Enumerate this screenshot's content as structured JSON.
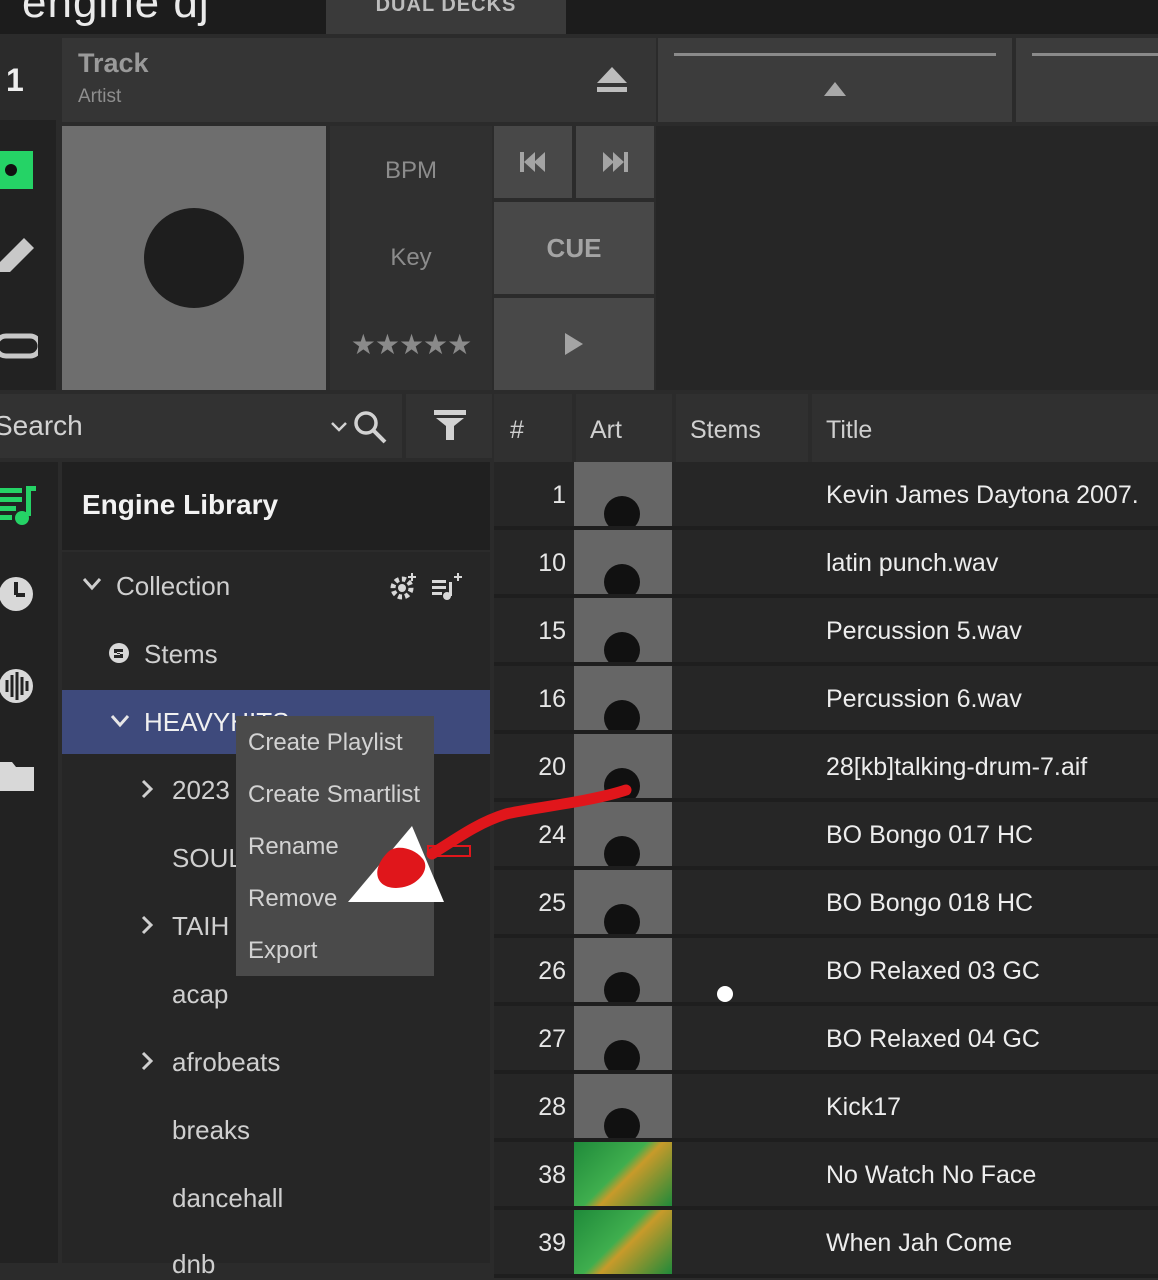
{
  "header": {
    "logo_text": "engine dj",
    "tab_label": "DUAL DECKS"
  },
  "deck": {
    "number": "1",
    "track_title": "Track",
    "artist": "Artist",
    "bpm_label": "BPM",
    "key_label": "Key",
    "rating_stars": "★★★★★",
    "cue_label": "CUE"
  },
  "search": {
    "placeholder": "Search"
  },
  "library": {
    "title": "Engine Library",
    "tree": [
      {
        "label": "Collection"
      },
      {
        "label": "Stems"
      },
      {
        "label": "HEAVYHITS"
      },
      {
        "label": "2023"
      },
      {
        "label": "SOUL"
      },
      {
        "label": "TAIH"
      },
      {
        "label": "acap"
      },
      {
        "label": "afrobeats"
      },
      {
        "label": "breaks"
      },
      {
        "label": "dancehall"
      },
      {
        "label": "dnb"
      }
    ]
  },
  "context_menu": {
    "items": [
      "Create Playlist",
      "Create Smartlist",
      "Rename",
      "Remove",
      "Export"
    ]
  },
  "table": {
    "columns": [
      "#",
      "Art",
      "Stems",
      "Title"
    ],
    "rows": [
      {
        "num": "1",
        "title": "Kevin James Daytona 2007."
      },
      {
        "num": "10",
        "title": "latin punch.wav"
      },
      {
        "num": "15",
        "title": "Percussion 5.wav"
      },
      {
        "num": "16",
        "title": "Percussion 6.wav"
      },
      {
        "num": "20",
        "title": "28[kb]talking-drum-7.aif"
      },
      {
        "num": "24",
        "title": "BO Bongo 017 HC"
      },
      {
        "num": "25",
        "title": "BO Bongo 018 HC"
      },
      {
        "num": "26",
        "title": "BO Relaxed 03 GC"
      },
      {
        "num": "27",
        "title": "BO Relaxed 04 GC"
      },
      {
        "num": "28",
        "title": "Kick17"
      },
      {
        "num": "38",
        "title": "No Watch No Face"
      },
      {
        "num": "39",
        "title": "When Jah Come"
      }
    ]
  },
  "colors": {
    "accent_green": "#25d366",
    "selection": "#3e4a7c",
    "annotation_red": "#e0161b"
  }
}
